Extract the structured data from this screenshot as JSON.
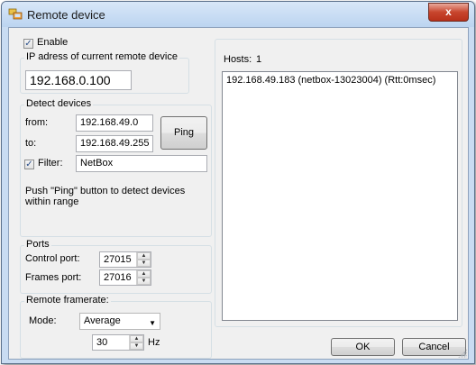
{
  "window": {
    "title": "Remote device",
    "close_glyph": "x"
  },
  "enable": {
    "label": "Enable",
    "checked": true
  },
  "ip_group": {
    "label": "IP adress of current remote device",
    "value": "192.168.0.100"
  },
  "detect": {
    "label": "Detect devices",
    "from_label": "from:",
    "from_value": "192.168.49.0",
    "to_label": "to:",
    "to_value": "192.168.49.255",
    "ping_label": "Ping",
    "filter_label": "Filter:",
    "filter_checked": true,
    "filter_value": "NetBox",
    "hint": "Push \"Ping\" button to detect devices within range"
  },
  "ports": {
    "label": "Ports",
    "control_label": "Control port:",
    "control_value": "27015",
    "frames_label": "Frames port:",
    "frames_value": "27016"
  },
  "framerate": {
    "label": "Remote framerate:",
    "mode_label": "Mode:",
    "mode_value": "Average",
    "rate_value": "30",
    "unit": "Hz"
  },
  "hosts": {
    "label": "Hosts:",
    "count": "1",
    "items": [
      "192.168.49.183 (netbox-13023004) (Rtt:0msec)"
    ]
  },
  "buttons": {
    "ok": "OK",
    "cancel": "Cancel"
  },
  "colors": {
    "titlebar": "#c9dcf2",
    "close": "#c8452d",
    "dialog": "#f0f0f0"
  }
}
